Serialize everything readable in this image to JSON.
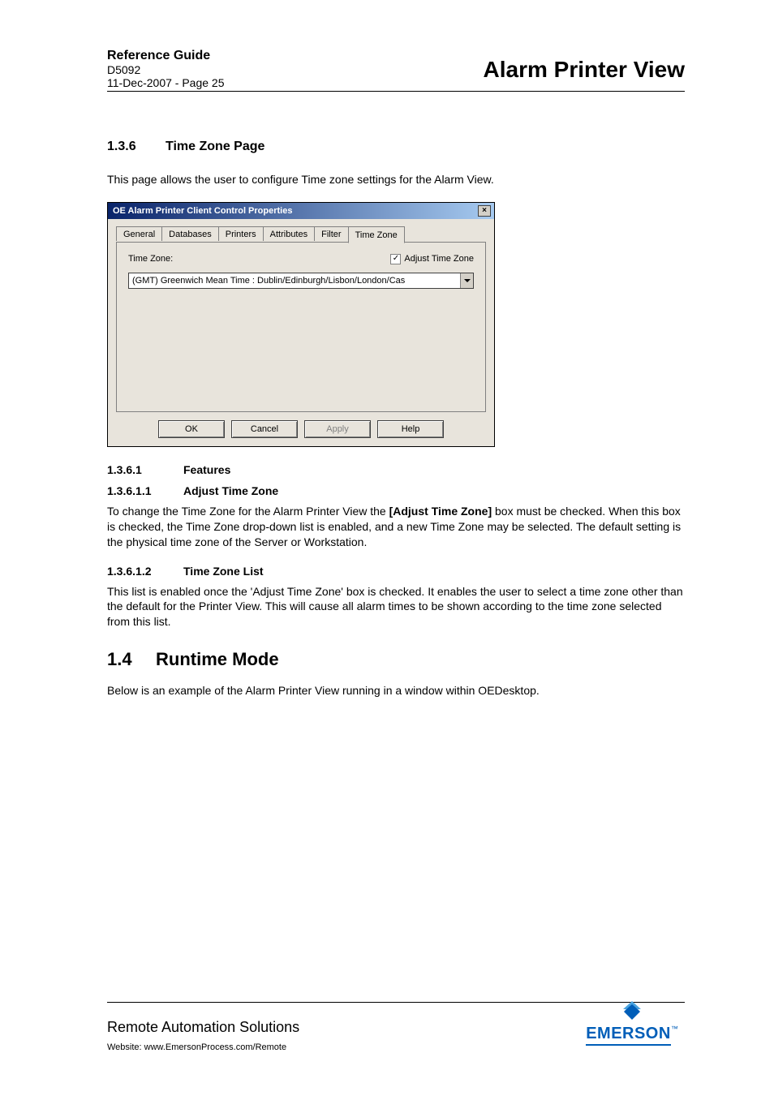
{
  "header": {
    "guide_title": "Reference Guide",
    "doc_number": "D5092",
    "page_info": "11-Dec-2007 - Page 25",
    "doc_title": "Alarm Printer View"
  },
  "section_1_3_6": {
    "num": "1.3.6",
    "title": "Time Zone Page",
    "intro": "This page allows the user to configure Time zone settings for the Alarm View."
  },
  "dialog": {
    "title": "OE Alarm Printer Client Control Properties",
    "close_glyph": "×",
    "tabs": {
      "general": "General",
      "databases": "Databases",
      "printers": "Printers",
      "attributes": "Attributes",
      "filter": "Filter",
      "timezone": "Time Zone"
    },
    "tz_label": "Time Zone:",
    "adjust_label": "Adjust Time Zone",
    "check_glyph": "✓",
    "tz_select_value": "(GMT) Greenwich Mean Time : Dublin/Edinburgh/Lisbon/London/Cas",
    "buttons": {
      "ok": "OK",
      "cancel": "Cancel",
      "apply": "Apply",
      "help": "Help"
    }
  },
  "section_1_3_6_1": {
    "num": "1.3.6.1",
    "title": "Features"
  },
  "section_1_3_6_1_1": {
    "num": "1.3.6.1.1",
    "title": "Adjust Time Zone",
    "body_pre": "To change the Time Zone for the Alarm Printer View the ",
    "body_bold": "[Adjust Time Zone]",
    "body_post": " box must be checked. When this box is checked, the Time Zone drop-down list is enabled, and a new Time Zone may be selected. The default setting is the physical time zone of the Server or Workstation."
  },
  "section_1_3_6_1_2": {
    "num": "1.3.6.1.2",
    "title": "Time Zone List",
    "body": "This list is enabled once the 'Adjust Time Zone' box is checked. It enables the user to select a time zone other than the default for the Printer View. This will cause all alarm times to be shown according to the time zone selected from this list."
  },
  "section_1_4": {
    "num": "1.4",
    "title": "Runtime Mode",
    "body": "Below is an example of the Alarm Printer View running in a window within OEDesktop."
  },
  "footer": {
    "company": "Remote Automation Solutions",
    "website": "Website:  www.EmersonProcess.com/Remote",
    "logo_text": "EMERSON",
    "tm": "™"
  }
}
